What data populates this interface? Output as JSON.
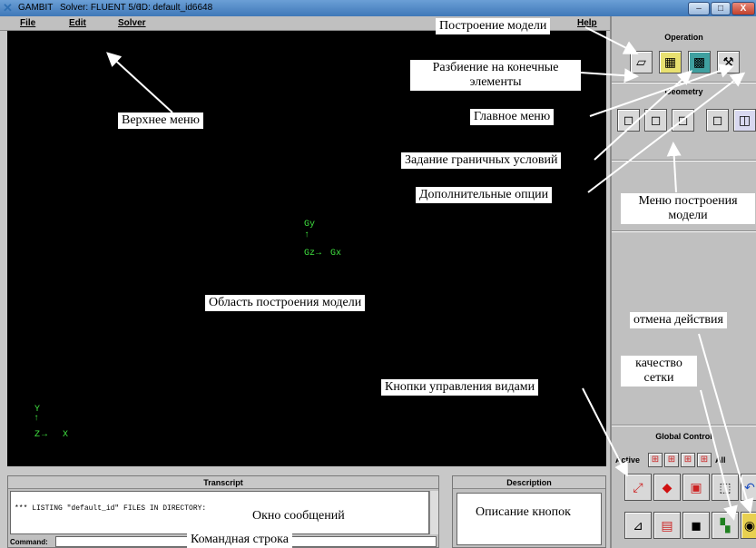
{
  "window": {
    "app_name": "GAMBIT",
    "solver": "Solver: FLUENT 5/6",
    "id": "ID: default_id6648",
    "minimize": "–",
    "maximize": "□",
    "close": "X"
  },
  "menu": {
    "file": "File",
    "edit": "Edit",
    "solver": "Solver",
    "help": "Help"
  },
  "axes": {
    "y_big": "Gy",
    "z_big": "Gz",
    "x_big": "Gx",
    "y_small": "Y",
    "z_small": "Z",
    "x_small": "X"
  },
  "panel": {
    "operation": "Operation",
    "geometry": "Geometry",
    "global_control": "Global Control",
    "active": "Active",
    "all": "All"
  },
  "transcript": {
    "title": "Transcript",
    "line": "*** LISTING \"default_id\" FILES IN DIRECTORY:",
    "command_label": "Command:"
  },
  "description": {
    "title": "Description"
  },
  "annotations": {
    "build_model": "Построение модели",
    "meshing": "Разбиение на конечные элементы",
    "top_menu": "Верхнее меню",
    "main_menu": "Главное меню",
    "boundary": "Задание граничных условий",
    "extra": "Дополнительные опции",
    "build_menu": "Меню построения модели",
    "area": "Область построения модели",
    "undo": "отмена действия",
    "quality": "качество сетки",
    "view_buttons": "Кнопки управления видами",
    "message_window": "Окно сообщений",
    "button_desc": "Описание кнопок",
    "command_line": "Командная строка"
  }
}
